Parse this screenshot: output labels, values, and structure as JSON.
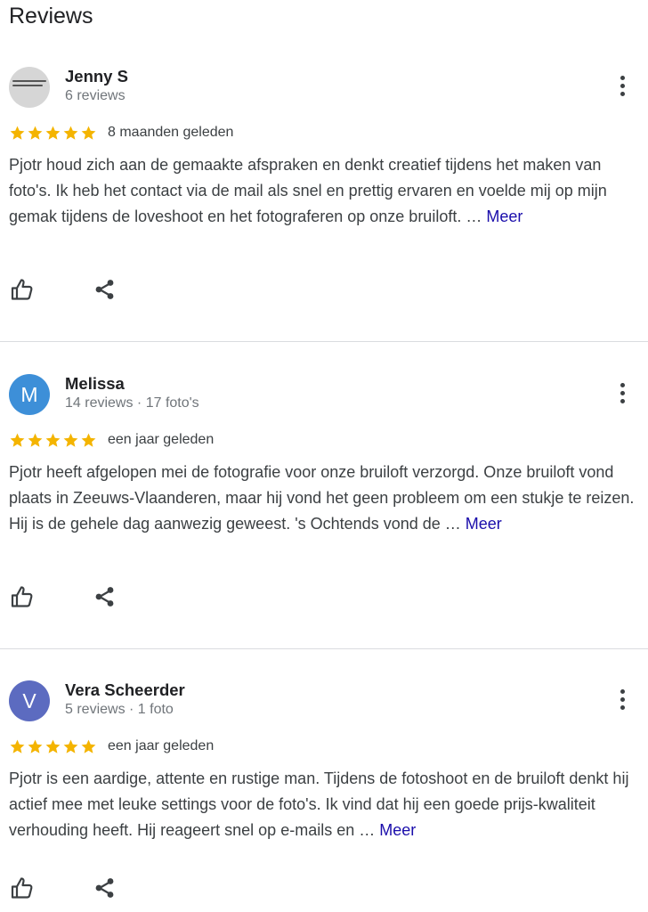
{
  "page": {
    "heading": "Reviews"
  },
  "reviews": [
    {
      "author": "Jenny S",
      "meta": "6 reviews",
      "avatar_initial": "",
      "avatar_color": "#d6d6d6",
      "rating": 5,
      "date": "8 maanden geleden",
      "text": "Pjotr houd zich aan de gemaakte afspraken en denkt creatief tijdens het maken van foto's. Ik heb het contact via de mail als snel en prettig ervaren en voelde mij op mijn gemak tijdens de loveshoot en het fotograferen op onze bruiloft. …",
      "more_label": "Meer"
    },
    {
      "author": "Melissa",
      "meta": "14 reviews · 17 foto's",
      "avatar_initial": "M",
      "avatar_color": "#3d8fd8",
      "rating": 5,
      "date": "een jaar geleden",
      "text": "Pjotr heeft afgelopen mei de fotografie voor onze bruiloft verzorgd. Onze bruiloft vond plaats in Zeeuws-Vlaanderen, maar hij vond het geen probleem om een stukje te reizen. Hij is de gehele dag aanwezig geweest. 's Ochtends vond de …",
      "more_label": "Meer"
    },
    {
      "author": "Vera Scheerder",
      "meta": "5 reviews · 1 foto",
      "avatar_initial": "V",
      "avatar_color": "#5c6bc0",
      "rating": 5,
      "date": "een jaar geleden",
      "text": "Pjotr is een aardige, attente en rustige man. Tijdens de fotoshoot en de bruiloft denkt hij actief mee met leuke settings voor de foto's. Ik vind dat hij een goede prijs-kwaliteit verhouding heeft. Hij reageert snel op e-mails en …",
      "more_label": "Meer"
    }
  ],
  "icons": {
    "star": "star-icon",
    "more": "more-vert-icon",
    "like": "thumb-up-icon",
    "share": "share-icon"
  },
  "colors": {
    "star": "#f4b400",
    "link": "#1a0dab",
    "divider": "#dadce0"
  }
}
